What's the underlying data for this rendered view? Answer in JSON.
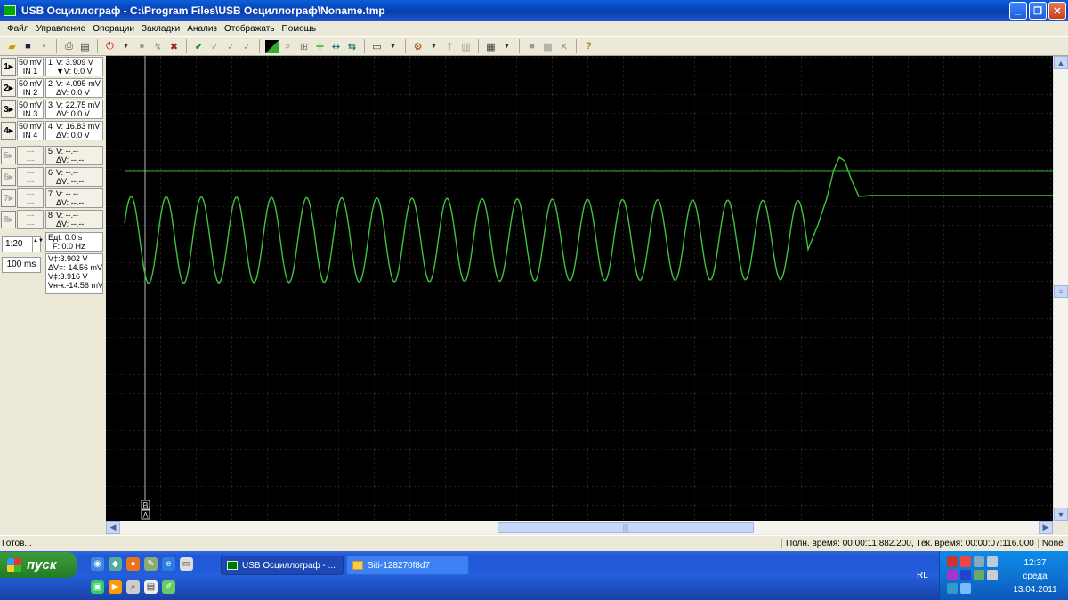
{
  "window": {
    "title": "USB Осциллограф - C:\\Program Files\\USB Осциллограф\\Noname.tmp"
  },
  "menu": [
    "Файл",
    "Управление",
    "Операции",
    "Закладки",
    "Анализ",
    "Отображать",
    "Помощь"
  ],
  "channels": [
    {
      "btn": "1▸",
      "scale": "50 mV",
      "input": "IN 1",
      "num": "1",
      "l1": "V:",
      "v1": "3.909 V",
      "l2": "▼V:",
      "v2": "0.0 V",
      "enabled": true
    },
    {
      "btn": "2▸",
      "scale": "50 mV",
      "input": "IN 2",
      "num": "2",
      "l1": "V:",
      "v1": "-4.095 mV",
      "l2": "ΔV:",
      "v2": "0.0 V",
      "enabled": true
    },
    {
      "btn": "3▸",
      "scale": "50 mV",
      "input": "IN 3",
      "num": "3",
      "l1": "V:",
      "v1": "22.75 mV",
      "l2": "ΔV:",
      "v2": "0.0 V",
      "enabled": true
    },
    {
      "btn": "4▸",
      "scale": "50 mV",
      "input": "IN 4",
      "num": "4",
      "l1": "V:",
      "v1": "16.83 mV",
      "l2": "ΔV:",
      "v2": "0.0 V",
      "enabled": true
    },
    {
      "btn": "5▸",
      "scale": "---",
      "input": "---",
      "num": "5",
      "l1": "V:",
      "v1": "--.--",
      "l2": "ΔV:",
      "v2": "--.--",
      "enabled": false
    },
    {
      "btn": "6▸",
      "scale": "---",
      "input": "---",
      "num": "6",
      "l1": "V:",
      "v1": "--.--",
      "l2": "ΔV:",
      "v2": "--.--",
      "enabled": false
    },
    {
      "btn": "7▸",
      "scale": "---",
      "input": "---",
      "num": "7",
      "l1": "V:",
      "v1": "--.--",
      "l2": "ΔV:",
      "v2": "--.--",
      "enabled": false
    },
    {
      "btn": "8▸",
      "scale": "---",
      "input": "---",
      "num": "8",
      "l1": "V:",
      "v1": "--.--",
      "l2": "ΔV:",
      "v2": "--.--",
      "enabled": false
    }
  ],
  "timing": {
    "zoom": "1:20",
    "zoom_spin": "▲▼",
    "timebase": "100 ms",
    "dt_label": "Eдt:",
    "dt": "0.0 s",
    "f_label": "F:",
    "f": "0.0 Hz"
  },
  "measurements": [
    {
      "label": "V‡:",
      "value": "3.902 V"
    },
    {
      "label": "ΔV‡:",
      "value": "-14.56 mV"
    },
    {
      "label": "V‡:",
      "value": "3.916 V"
    },
    {
      "label": "Vн-к:",
      "value": "-14.56 mV"
    }
  ],
  "cursors": {
    "b": "B",
    "a": "A"
  },
  "scrollbars": {
    "up": "▲",
    "down": "▼",
    "left": "◀",
    "right": "▶",
    "grip": "≡",
    "hgrip": "|||"
  },
  "status": {
    "left": "Готов...",
    "times": "Полн. время: 00:00:11:882.200, Тек. время: 00:00:07:116.000",
    "mode": "None"
  },
  "taskbar": {
    "start": "пуск",
    "tasks": [
      "USB Осциллограф - ...",
      "Siti-128270f8d7"
    ],
    "lang": "RL",
    "time": "12:37",
    "day": "среда",
    "date": "13.04.2011"
  }
}
